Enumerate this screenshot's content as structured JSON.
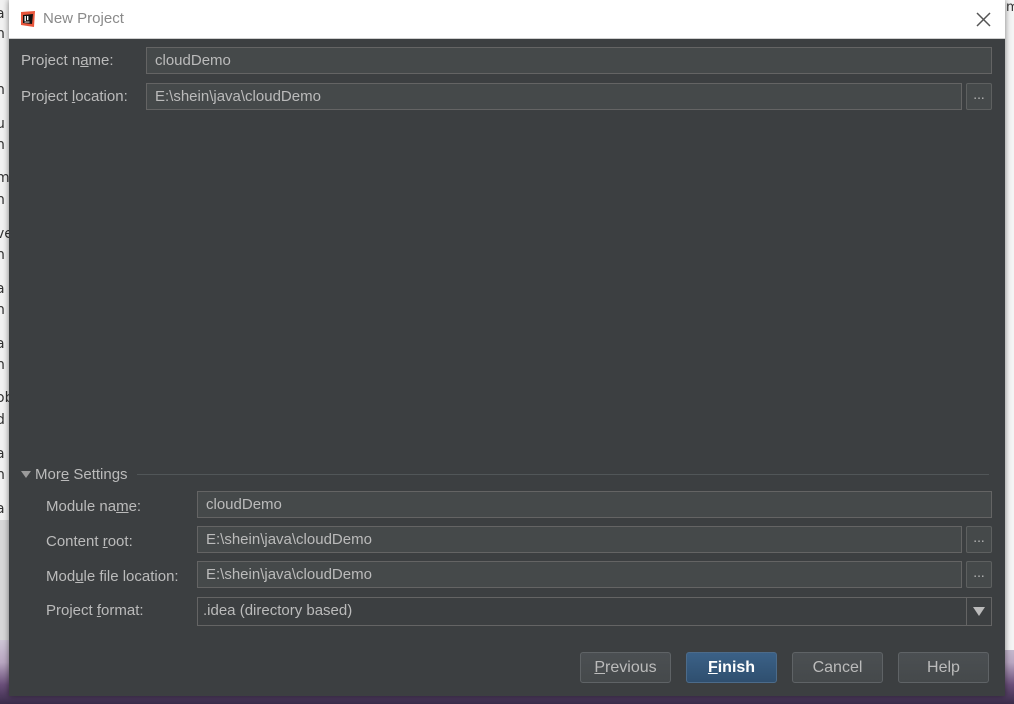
{
  "dialog": {
    "title": "New Project"
  },
  "form": {
    "project_name_label_pre": "Project n",
    "project_name_label_ul": "a",
    "project_name_label_post": "me:",
    "project_name_value": "cloudDemo",
    "project_location_label_pre": "Project ",
    "project_location_label_ul": "l",
    "project_location_label_post": "ocation:",
    "project_location_value": "E:\\shein\\java\\cloudDemo",
    "browse_label": "..."
  },
  "more_settings": {
    "label_pre": "Mor",
    "label_ul": "e",
    "label_post": " Settings",
    "module_name_label_pre": "Module na",
    "module_name_label_ul": "m",
    "module_name_label_post": "e:",
    "module_name_value": "cloudDemo",
    "content_root_label_pre": "Content ",
    "content_root_label_ul": "r",
    "content_root_label_post": "oot:",
    "content_root_value": "E:\\shein\\java\\cloudDemo",
    "module_file_label_pre": "Mod",
    "module_file_label_ul": "u",
    "module_file_label_post": "le file location:",
    "module_file_value": "E:\\shein\\java\\cloudDemo",
    "project_format_label_pre": "Project ",
    "project_format_label_ul": "f",
    "project_format_label_post": "ormat:",
    "project_format_value": ".idea (directory based)"
  },
  "buttons": {
    "previous_ul": "P",
    "previous_rest": "revious",
    "finish_ul": "F",
    "finish_rest": "inish",
    "cancel": "Cancel",
    "help": "Help"
  },
  "background": {
    "left_glyphs": [
      "a",
      "h",
      "h",
      "u",
      "h",
      "m",
      "h",
      "ve",
      "h",
      "a",
      "h",
      "a",
      "h",
      "ob",
      "d",
      "a",
      "h",
      "a"
    ],
    "right_glyph": "m"
  },
  "colors": {
    "dialog_bg": "#3c3f41",
    "field_bg": "#45494a",
    "text": "#bbbbbb",
    "primary_button": "#365880"
  }
}
